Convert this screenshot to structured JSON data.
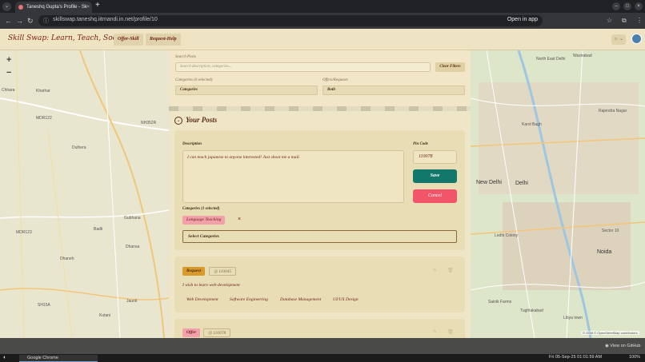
{
  "browser": {
    "tab_title": "Taneshq Gupta's Profile - Sk",
    "tab_close": "×",
    "new_tab": "+",
    "menu_glyph": "⌄",
    "url": "skillswap.taneshq.iitmandi.in.net/profile/10",
    "open_in_app": "Open in app",
    "back_glyph": "←",
    "forward_glyph": "→",
    "reload_glyph": "↻",
    "minimize_glyph": "–",
    "maximize_glyph": "□",
    "close_glyph": "×",
    "bookmark_glyph": "☆",
    "menu_dots": "⋮"
  },
  "navbar": {
    "brand": "Skill Swap: Learn, Teach, Socialize",
    "offer_skill": "Offer-Skill",
    "request_help": "Request-Help",
    "theme_glyph": "☼ ⌄"
  },
  "filters": {
    "search_label": "Search Posts",
    "search_placeholder": "Search description, categories...",
    "clear_filters": "Clear Filters",
    "categories_label": "Categories (0 selected)",
    "categories_value": "Categories",
    "offers_label": "Offers/Requests",
    "offers_value": "Both"
  },
  "your_posts": {
    "icon_glyph": "⌄",
    "title": "Your Posts"
  },
  "edit_post": {
    "description_label": "Description",
    "description_value": "I can teach japanese to anyone interested! Just shoot me a mail.",
    "pin_label": "Pin Code",
    "pin_value": "110078",
    "save": "Save",
    "cancel": "Cancel",
    "categories_label": "Categories (1 selected)",
    "selected_chip": "Language Teaching",
    "chip_remove": "×",
    "select_categories": "Select Categories"
  },
  "posts": [
    {
      "type": "Request",
      "pin": "110045",
      "pin_glyph": "◎",
      "description": "I wish to learn web-development",
      "skills": [
        "Web Development",
        "Software Engineering",
        "Database Management",
        "UI/UX Design"
      ],
      "edit_glyph": "✎",
      "delete_glyph": "🗑"
    },
    {
      "type": "Offer",
      "pin": "110078",
      "pin_glyph": "◎",
      "edit_glyph": "✎",
      "delete_glyph": "🗑"
    }
  ],
  "map_left": {
    "zoom_in": "+",
    "zoom_out": "−",
    "labels": [
      "Chhara",
      "Kharhar",
      "MDR122",
      "NH352R",
      "Dulhera",
      "Gubhana",
      "MDR123",
      "Badli",
      "Dhansa",
      "Dhaneh",
      "Jaunti",
      "SH15A",
      "Kutani"
    ]
  },
  "map_right": {
    "labels": [
      "Wazirabad",
      "North East Delhi",
      "Karol Bagh",
      "Rajendra Nagar",
      "New Delhi",
      "Delhi",
      "Noida",
      "Sector 10",
      "Lodhi Colony",
      "Sainik Farms",
      "Tughlakabad",
      "Libya town"
    ],
    "attribution": "© OSM © OpenStreetMap contributors"
  },
  "github_bar": {
    "label": "View on GitHub"
  },
  "taskbar": {
    "logo_glyph": "◐",
    "app": "Google Chrome",
    "datetime": "Fri 05-Sep-25 01:01:59 AM",
    "battery": "100%"
  },
  "colors": {
    "brand": "#7a1f12",
    "save": "#12786b",
    "cancel": "#f2546a",
    "request_tag": "#d99a2b",
    "offer_tag": "#f2a0aa",
    "page_bg": "#efe5c6"
  }
}
